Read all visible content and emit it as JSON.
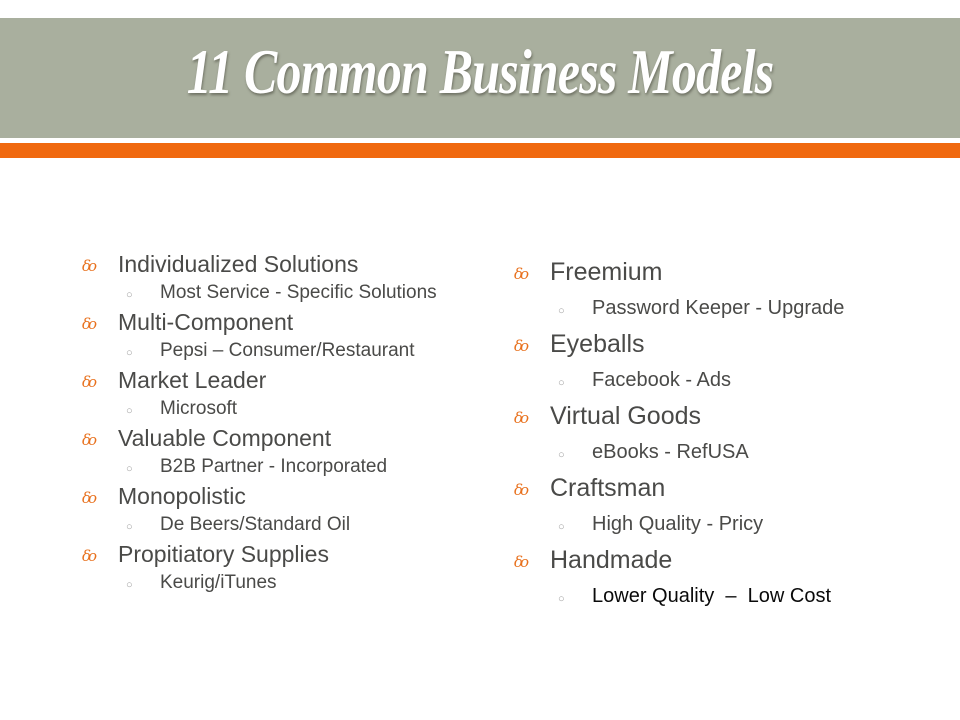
{
  "slide": {
    "title": "11 Common Business Models",
    "colors": {
      "title_band": "#a9af9e",
      "accent_bar": "#f0690f",
      "bullet": "#e8711e",
      "text": "#4a4a48"
    },
    "bullet_icon": "fleuron-bullet-icon",
    "sub_bullet_icon": "hollow-circle-icon"
  },
  "left_column": [
    {
      "label": "Individualized Solutions",
      "sub": "Most Service - Specific Solutions"
    },
    {
      "label": "Multi-Component",
      "sub": "Pepsi – Consumer/Restaurant"
    },
    {
      "label": "Market Leader",
      "sub": "Microsoft"
    },
    {
      "label": "Valuable Component",
      "sub": "B2B Partner - Incorporated"
    },
    {
      "label": "Monopolistic",
      "sub": "De Beers/Standard Oil"
    },
    {
      "label": "Propitiatory Supplies",
      "sub": "Keurig/iTunes"
    }
  ],
  "right_column": [
    {
      "label": "Freemium",
      "sub": "Password Keeper - Upgrade"
    },
    {
      "label": "Eyeballs",
      "sub": "Facebook - Ads"
    },
    {
      "label": "Virtual Goods",
      "sub": "eBooks - RefUSA"
    },
    {
      "label": "Craftsman",
      "sub": "High Quality - Pricy"
    },
    {
      "label": "Handmade",
      "sub": "Lower Quality  –  Low Cost"
    }
  ],
  "glyphs": {
    "bullet": "෴",
    "bullet_fallback": "δο",
    "sub_bullet": "○"
  }
}
